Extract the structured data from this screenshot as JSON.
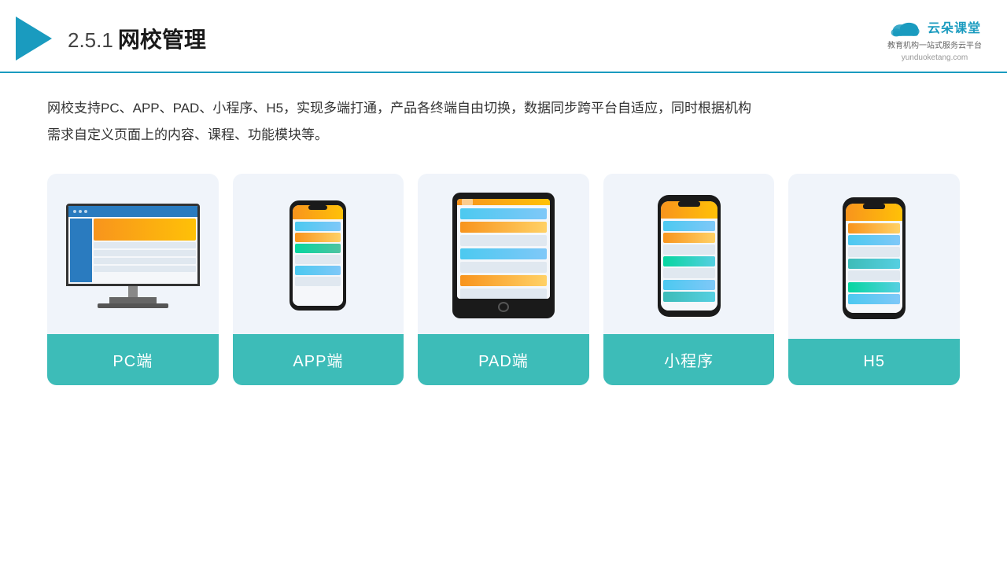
{
  "header": {
    "title_number": "2.5.1",
    "title_text": "网校管理",
    "brand_name": "云朵课堂",
    "brand_tagline": "教育机构一站\n式服务云平台",
    "brand_url": "yunduoketang.com"
  },
  "description": "网校支持PC、APP、PAD、小程序、H5，实现多端打通，产品各终端自由切换，数据同步跨平台自适应，同时根据机构\n需求自定义页面上的内容、课程、功能模块等。",
  "cards": [
    {
      "id": "pc",
      "label": "PC端"
    },
    {
      "id": "app",
      "label": "APP端"
    },
    {
      "id": "pad",
      "label": "PAD端"
    },
    {
      "id": "miniprogram",
      "label": "小程序"
    },
    {
      "id": "h5",
      "label": "H5"
    }
  ],
  "colors": {
    "accent": "#1a9bbf",
    "card_label_bg": "#3dbcb8",
    "card_label_text": "#ffffff",
    "card_bg": "#f0f4fa"
  }
}
